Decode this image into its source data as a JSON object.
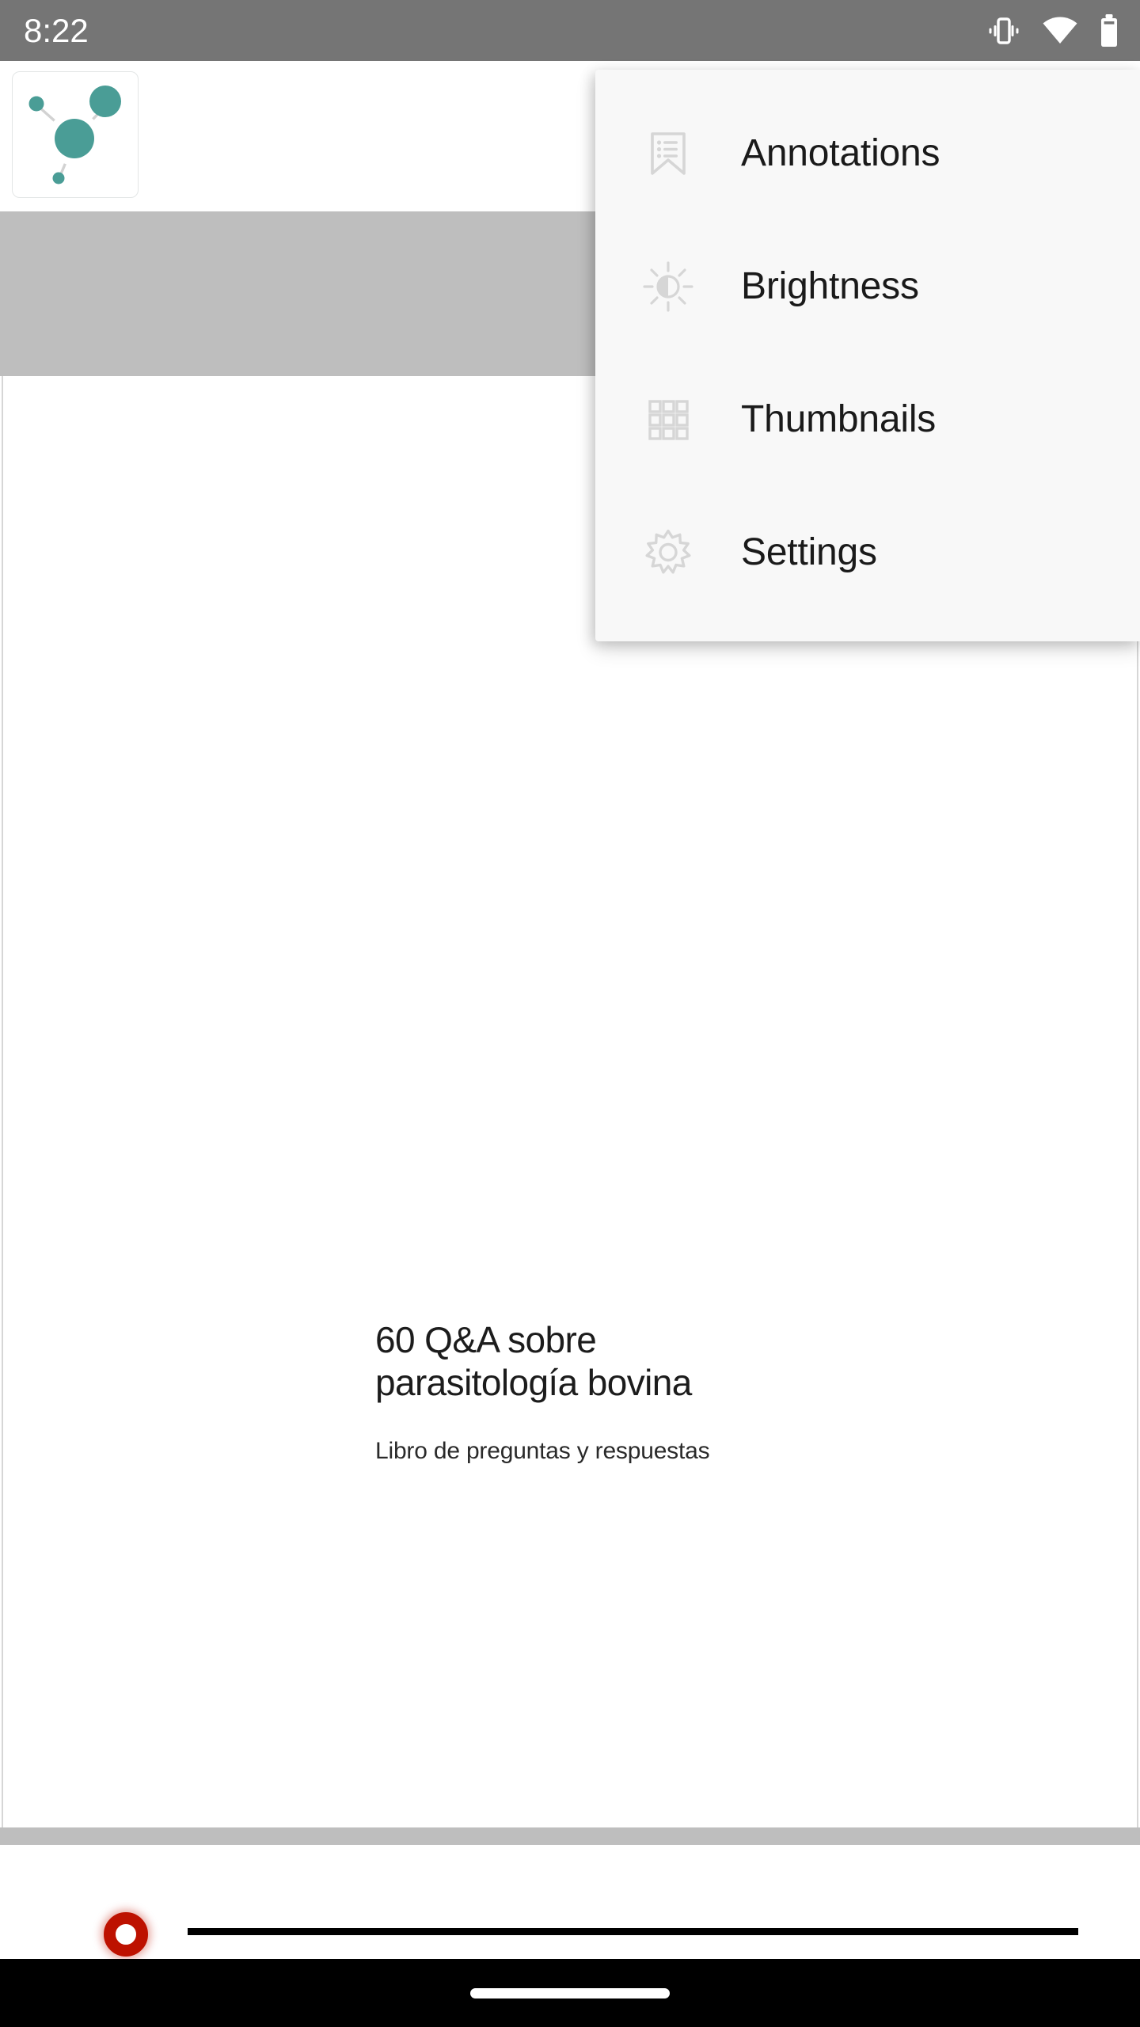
{
  "status_bar": {
    "time": "8:22",
    "icons": [
      "vibrate-icon",
      "wifi-icon",
      "battery-icon"
    ],
    "background_color": "#757575"
  },
  "toolbar": {
    "app_logo_icon": "network-nodes-logo",
    "logo_accent_color": "#4a9d96"
  },
  "overflow_menu": {
    "background_color": "#f8f8f8",
    "items": [
      {
        "icon": "annotations-bookmark-icon",
        "label": "Annotations"
      },
      {
        "icon": "brightness-half-sun-icon",
        "label": "Brightness"
      },
      {
        "icon": "thumbnails-grid-icon",
        "label": "Thumbnails"
      },
      {
        "icon": "settings-gear-icon",
        "label": "Settings"
      }
    ]
  },
  "document": {
    "page_background_color": "#ffffff",
    "backdrop_color": "#bebebe",
    "title": "60 Q&A sobre\nparasitología bovina",
    "subtitle": "Libro de preguntas y respuestas"
  },
  "scrubber": {
    "thumb_color": "#bd1100",
    "track_color": "#000000"
  },
  "navigation_bar": {
    "background_color": "#000000",
    "handle_name": "home-indicator"
  }
}
